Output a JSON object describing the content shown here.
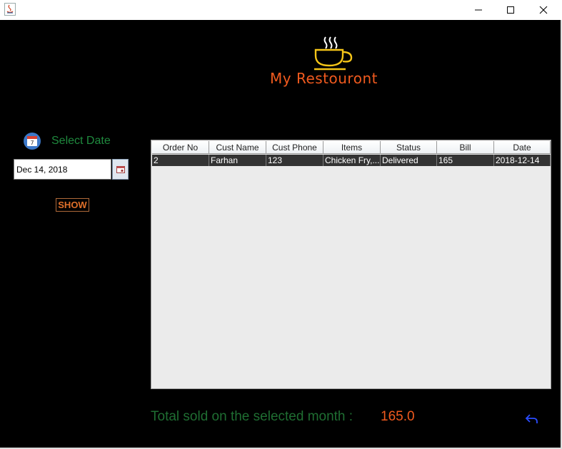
{
  "window": {
    "icons": {
      "app": "java-icon",
      "minimize": "minimize-icon",
      "maximize": "maximize-icon",
      "close": "close-icon"
    }
  },
  "header": {
    "title": "My Restouront",
    "logo_icon": "coffee-cup-icon",
    "title_color": "#f05a1e",
    "logo_color": "#f5c518"
  },
  "filter": {
    "label": "Select Date",
    "calendar_icon": "calendar-icon",
    "date_value": "Dec 14, 2018",
    "picker_icon": "date-picker-icon",
    "show_label": "SHOW"
  },
  "table": {
    "columns": [
      "Order No",
      "Cust Name",
      "Cust Phone",
      "Items",
      "Status",
      "Bill",
      "Date"
    ],
    "rows": [
      [
        "2",
        "Farhan",
        "123",
        "Chicken Fry,...",
        "Delivered",
        "165",
        "2018-12-14"
      ]
    ]
  },
  "footer": {
    "total_label": "Total sold on the selected month :",
    "total_value": "165.0",
    "back_icon": "back-arrow-icon",
    "label_color": "#1f6e32",
    "value_color": "#f05a1e"
  }
}
